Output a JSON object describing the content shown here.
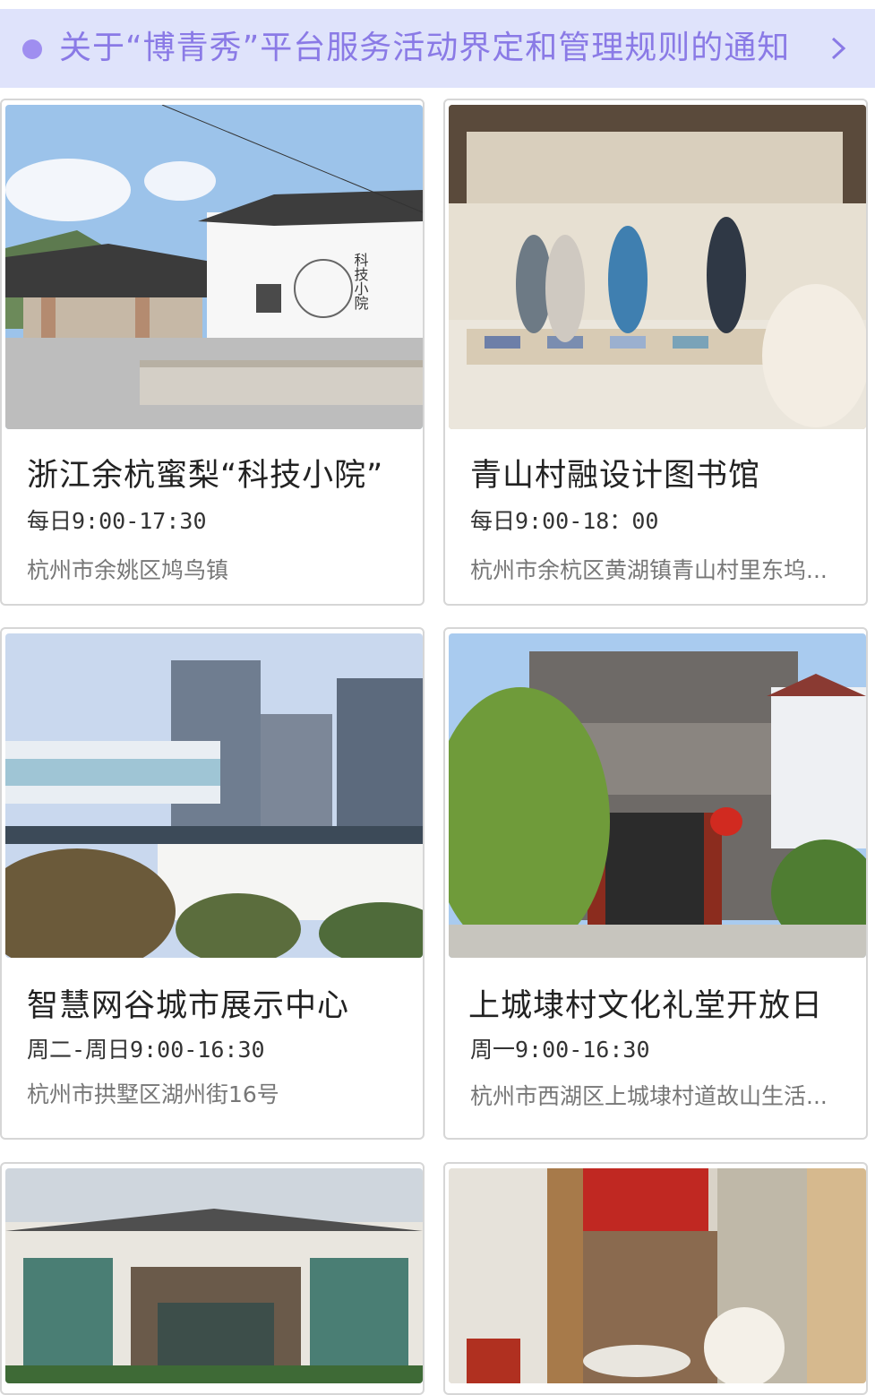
{
  "notice": {
    "text": "关于“博青秀”平台服务活动界定和管理规则的通知",
    "icon": "chevron-right-icon",
    "accent": "#8a7ae6"
  },
  "cards": [
    {
      "title": "浙江余杭蜜梨“科技小院”",
      "hours": "每日9:00-17:30",
      "address": "杭州市余姚区鸠鸟镇",
      "image_text": "科技小院"
    },
    {
      "title": "青山村融设计图书馆",
      "hours": "每日9:00-18：00",
      "address": "杭州市余杭区黄湖镇青山村里东坞..."
    },
    {
      "title": "智慧网谷城市展示中心",
      "hours": "周二-周日9:00-16:30",
      "address": "杭州市拱墅区湖州街16号"
    },
    {
      "title": "上城埭村文化礼堂开放日",
      "hours": "周一9:00-16:30",
      "address": "杭州市西湖区上城埭村道故山生活..."
    },
    {
      "title": "",
      "hours": "",
      "address": ""
    },
    {
      "title": "",
      "hours": "",
      "address": ""
    }
  ]
}
